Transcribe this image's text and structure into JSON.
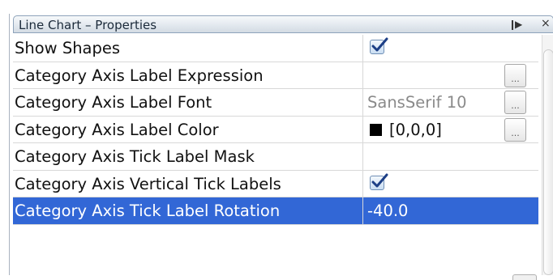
{
  "panel": {
    "title": "Line Chart – Properties",
    "pin_icon": "pin-icon",
    "close_icon": "close-icon"
  },
  "properties": [
    {
      "name": "Show Shapes",
      "type": "checkbox",
      "checked": true
    },
    {
      "name": "Category Axis Label Expression",
      "type": "text",
      "value": "",
      "has_button": true
    },
    {
      "name": "Category Axis Label Font",
      "type": "text",
      "value": "SansSerif 10",
      "muted": true,
      "has_button": true
    },
    {
      "name": "Category Axis Label Color",
      "type": "color",
      "value": "[0,0,0]",
      "color": "#000000",
      "has_button": true
    },
    {
      "name": "Category Axis Tick Label Mask",
      "type": "text",
      "value": ""
    },
    {
      "name": "Category Axis Vertical Tick Labels",
      "type": "checkbox",
      "checked": true
    },
    {
      "name": "Category Axis Tick Label Rotation",
      "type": "text",
      "value": "-40.0",
      "selected": true
    }
  ],
  "ellipsis_label": "...",
  "colors": {
    "selection": "#3267d6",
    "title_gradient_top": "#f7f9fb",
    "title_gradient_bottom": "#d3dbe3",
    "checkbox_border": "#6f8fb5"
  }
}
